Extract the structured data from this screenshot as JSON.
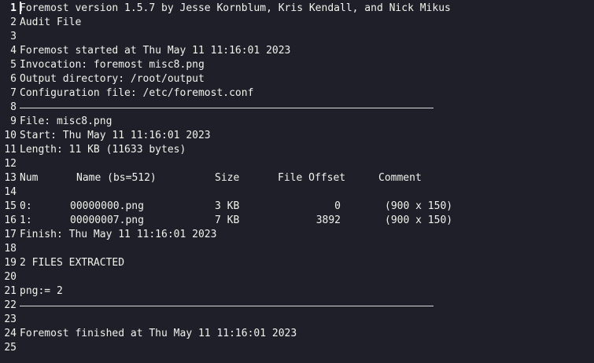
{
  "colors": {
    "background": "#1e1f29",
    "text": "#f1f2ec"
  },
  "lines": [
    {
      "n": "1",
      "text": "Foremost version 1.5.7 by Jesse Kornblum, Kris Kendall, and Nick Mikus"
    },
    {
      "n": "2",
      "text": "Audit File"
    },
    {
      "n": "3",
      "text": ""
    },
    {
      "n": "4",
      "text": "Foremost started at Thu May 11 11:16:01 2023"
    },
    {
      "n": "5",
      "text": "Invocation: foremost misc8.png"
    },
    {
      "n": "6",
      "text": "Output directory: /root/output"
    },
    {
      "n": "7",
      "text": "Configuration file: /etc/foremost.conf"
    },
    {
      "n": "8",
      "text": ""
    },
    {
      "n": "9",
      "text": "File: misc8.png"
    },
    {
      "n": "10",
      "text": "Start: Thu May 11 11:16:01 2023"
    },
    {
      "n": "11",
      "text": "Length: 11 KB (11633 bytes)"
    },
    {
      "n": "12",
      "text": ""
    },
    {
      "n": "13",
      "text": ""
    },
    {
      "n": "14",
      "text": ""
    },
    {
      "n": "15",
      "text": ""
    },
    {
      "n": "16",
      "text": ""
    },
    {
      "n": "17",
      "text": "Finish: Thu May 11 11:16:01 2023"
    },
    {
      "n": "18",
      "text": ""
    },
    {
      "n": "19",
      "text": "2 FILES EXTRACTED"
    },
    {
      "n": "20",
      "text": ""
    },
    {
      "n": "21",
      "text": "png:= 2"
    },
    {
      "n": "22",
      "text": ""
    },
    {
      "n": "23",
      "text": ""
    },
    {
      "n": "24",
      "text": "Foremost finished at Thu May 11 11:16:01 2023"
    },
    {
      "n": "25",
      "text": ""
    }
  ],
  "table": {
    "headers": {
      "num": "Num",
      "name": "Name (bs=512)",
      "size": "Size",
      "offset": "File Offset",
      "comment": "Comment"
    },
    "rows": [
      {
        "num": "0:",
        "name": "00000000.png",
        "size": "3 KB",
        "offset": "0",
        "comment": "(900 x 150)"
      },
      {
        "num": "1:",
        "name": "00000007.png",
        "size": "7 KB",
        "offset": "3892",
        "comment": "(900 x 150)"
      }
    ]
  }
}
